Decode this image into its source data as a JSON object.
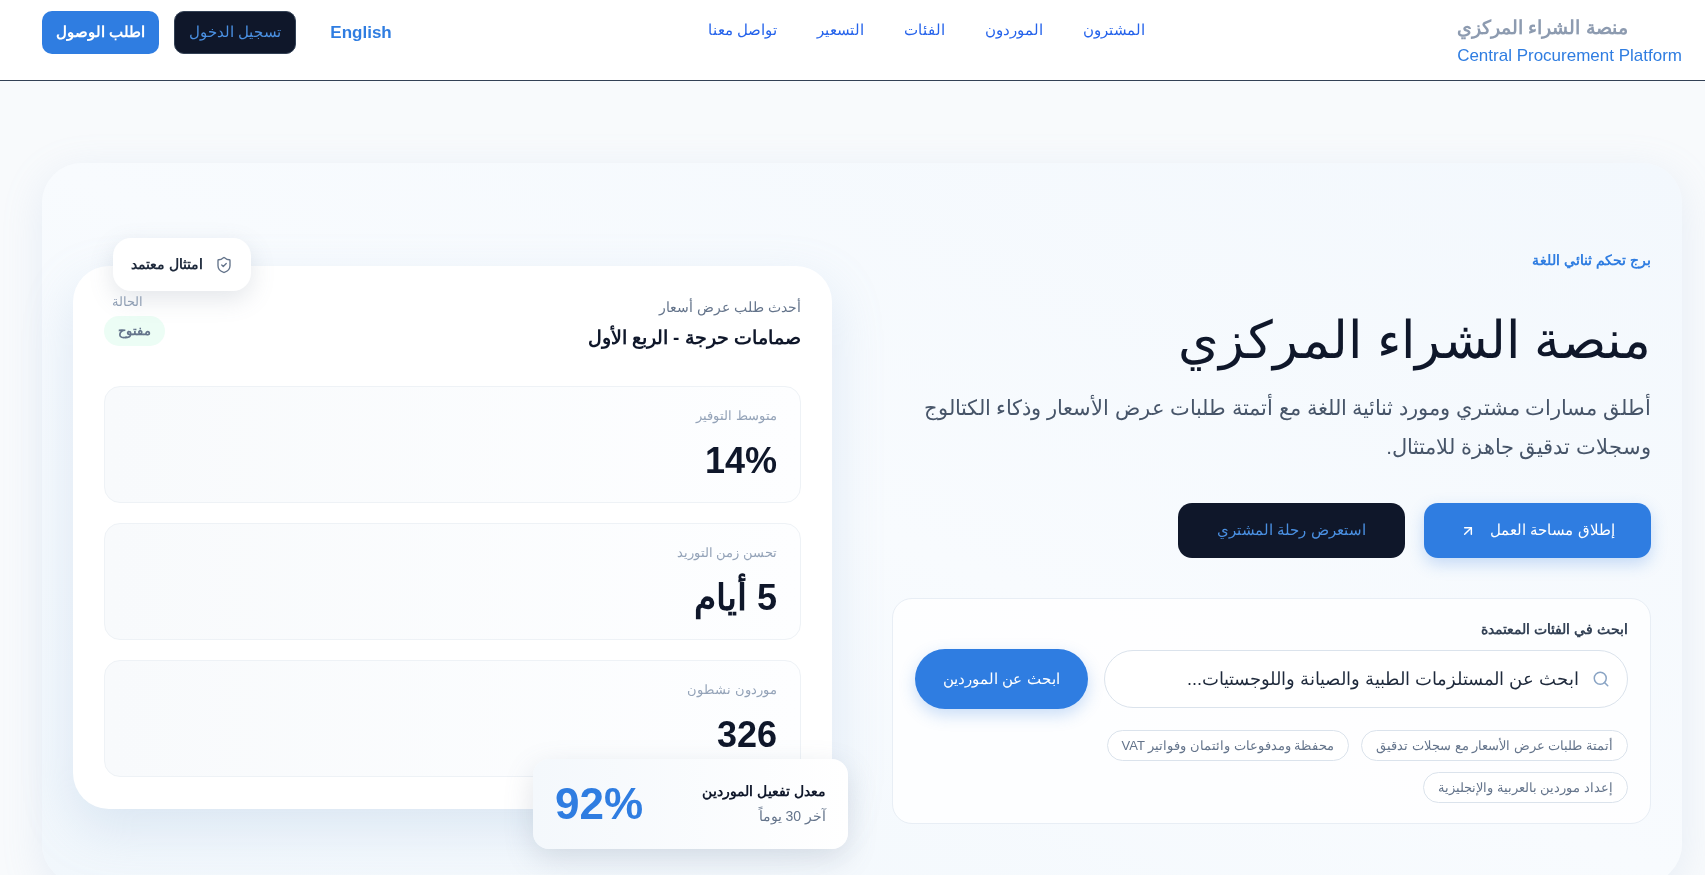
{
  "header": {
    "brand": {
      "title": "منصة الشراء المركزي",
      "subtitle": "Central Procurement Platform"
    },
    "nav": [
      "المشترون",
      "الموردون",
      "الفئات",
      "التسعير",
      "تواصل معنا"
    ],
    "language": "English",
    "buttons": [
      {
        "label": "تسجيل الدخول",
        "kind": "dark"
      },
      {
        "label": "اطلب الوصول",
        "kind": "primary"
      }
    ]
  },
  "hero": {
    "eyebrow": "برج تحكم ثنائي اللغة",
    "title": "منصة الشراء المركزي",
    "description": "أطلق مسارات مشتري ومورد ثنائية اللغة مع أتمتة طلبات عرض الأسعار وذكاء الكتالوج وسجلات تدقيق جاهزة للامتثال.",
    "actions": [
      {
        "label": "إطلاق مساحة العمل",
        "kind": "primary"
      },
      {
        "label": "استعرض رحلة المشتري",
        "kind": "dark"
      }
    ],
    "search": {
      "label": "ابحث في الفئات المعتمدة",
      "placeholder": "ابحث عن المستلزمات الطبية والصيانة واللوجستيات...",
      "button": "ابحث عن الموردين",
      "chips": [
        "أتمتة طلبات عرض الأسعار مع سجلات تدقيق",
        "محفظة ومدفوعات وائتمان وفواتير VAT",
        "إعداد موردين بالعربية والإنجليزية"
      ]
    }
  },
  "preview": {
    "badge": "امتثال معتمد",
    "caption": "أحدث طلب عرض أسعار",
    "title": "صمامات حرجة - الربع الأول",
    "status_label": "الحالة",
    "status": "مفتوح",
    "metrics": [
      {
        "label": "متوسط التوفير",
        "value": "14%"
      },
      {
        "label": "تحسن زمن التوريد",
        "value": "5 أيام"
      },
      {
        "label": "موردون نشطون",
        "value": "326"
      }
    ],
    "highlight": {
      "value": "92%",
      "label": "معدل تفعيل الموردين",
      "period": "آخر 30 يوماً"
    }
  }
}
